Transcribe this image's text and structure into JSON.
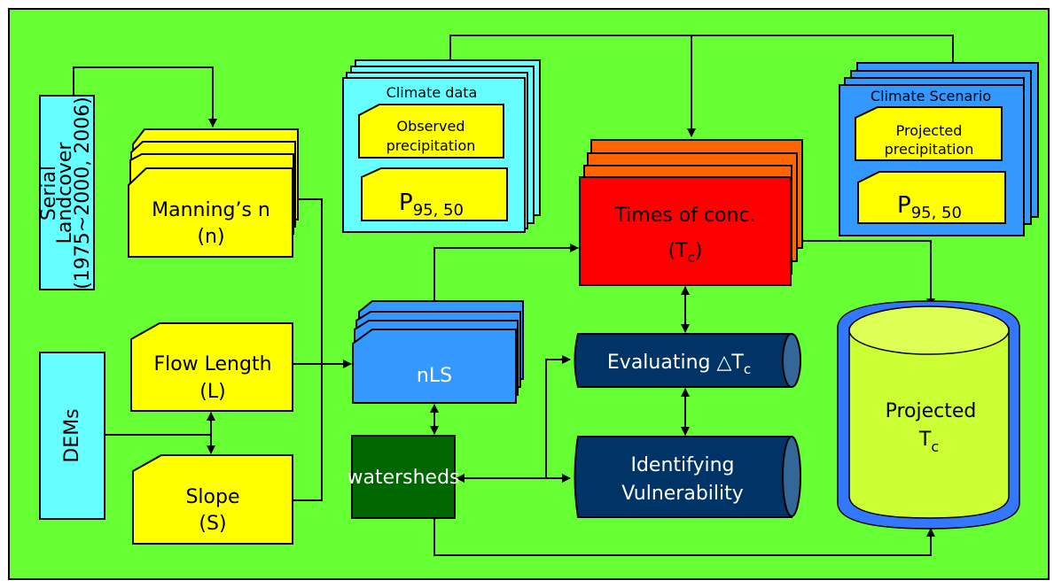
{
  "colors": {
    "background": "#66ff33",
    "landcover": "#66ffff",
    "input_card": "#ffff00",
    "climate_data": "#66ffff",
    "climate_scenario": "#3399ff",
    "nls": "#3399ff",
    "watersheds": "#006600",
    "times_front": "#ff0000",
    "times_back": "#ff6600",
    "process": "#003366",
    "projected_outer": "#3377ff",
    "projected_inner": "#ccff33"
  },
  "landcover": {
    "line1": "Serial",
    "line2": "Landcover",
    "line3": "(1975~2000, 2006)"
  },
  "dems": {
    "label": "DEMs"
  },
  "manning": {
    "line1": "Manning’s n",
    "line2": "(n)"
  },
  "flow_length": {
    "line1": "Flow Length",
    "line2": "(L)"
  },
  "slope": {
    "line1": "Slope",
    "line2": "(S)"
  },
  "nls": {
    "label": "nLS"
  },
  "watersheds": {
    "label": "watersheds"
  },
  "climate_data": {
    "title": "Climate data",
    "observed1": "Observed",
    "observed2": "precipitation",
    "p": "P",
    "p_sub": "95, 50"
  },
  "climate_scenario": {
    "title": "Climate Scenario",
    "projected1": "Projected",
    "projected2": "precipitation",
    "p": "P",
    "p_sub": "95, 50"
  },
  "times": {
    "line1": "Times of conc.",
    "open": "(T",
    "sub": "c",
    "close": ")"
  },
  "evaluating": {
    "label": "Evaluating △T",
    "sub": "c"
  },
  "identifying": {
    "line1": "Identifying",
    "line2": "Vulnerability"
  },
  "projected_tc": {
    "line1": "Projected",
    "t": "T",
    "sub": "c"
  }
}
